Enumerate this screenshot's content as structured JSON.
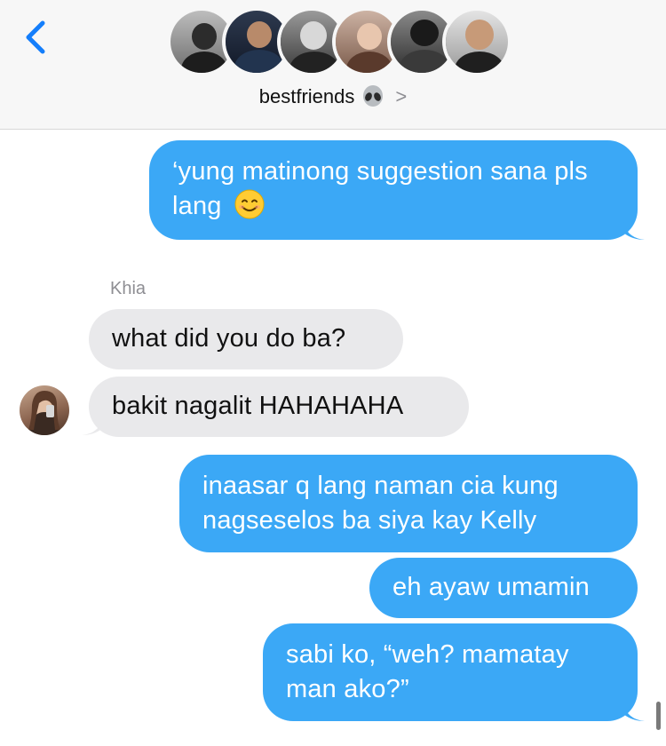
{
  "header": {
    "group_name": "bestfriends",
    "group_emoji_icon": "alien-icon",
    "chevron": ">",
    "back_icon": "chevron-left-icon",
    "accent": "#147efb"
  },
  "messages": [
    {
      "id": "m1",
      "direction": "outgoing",
      "text": "‘yung matinong suggestion sana pls lang",
      "emoji": "smiling-face-icon"
    },
    {
      "id": "m2",
      "direction": "incoming",
      "sender": "Khia",
      "text": "what did you do ba?"
    },
    {
      "id": "m3",
      "direction": "incoming",
      "text": "bakit nagalit HAHAHAHA"
    },
    {
      "id": "m4",
      "direction": "outgoing",
      "text": "inaasar q lang naman cia kung nagseselos ba siya kay Kelly"
    },
    {
      "id": "m5",
      "direction": "outgoing",
      "text": "eh ayaw umamin"
    },
    {
      "id": "m6",
      "direction": "outgoing",
      "text": "sabi ko, “weh? mamatay man ako?”"
    }
  ],
  "colors": {
    "outgoing_bubble": "#3ba8f6",
    "incoming_bubble": "#e9e9eb",
    "header_bg": "#f7f7f7"
  }
}
